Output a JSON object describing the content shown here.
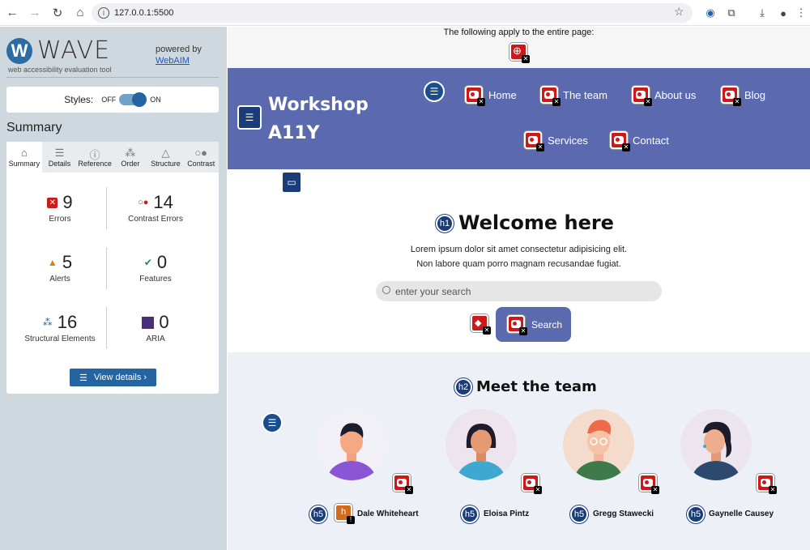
{
  "browser": {
    "url": "127.0.0.1:5500"
  },
  "wave": {
    "logo_text": "WAVE",
    "subtitle": "web accessibility evaluation tool",
    "powered_by": "powered by",
    "webaim_link": "WebAIM",
    "styles_label": "Styles:",
    "styles_off": "OFF",
    "styles_on": "ON",
    "summary_title": "Summary",
    "tabs": [
      {
        "label": "Summary",
        "icon": "home-icon"
      },
      {
        "label": "Details",
        "icon": "list-icon"
      },
      {
        "label": "Reference",
        "icon": "info-icon"
      },
      {
        "label": "Order",
        "icon": "order-icon"
      },
      {
        "label": "Structure",
        "icon": "structure-icon"
      },
      {
        "label": "Contrast",
        "icon": "contrast-icon"
      }
    ],
    "stats": {
      "errors": {
        "count": "9",
        "label": "Errors"
      },
      "contrast_errors": {
        "count": "14",
        "label": "Contrast Errors"
      },
      "alerts": {
        "count": "5",
        "label": "Alerts"
      },
      "features": {
        "count": "0",
        "label": "Features"
      },
      "structural": {
        "count": "16",
        "label": "Structural Elements"
      },
      "aria": {
        "count": "0",
        "label": "ARIA"
      }
    },
    "view_details": "View details ›"
  },
  "page": {
    "top_note": "The following apply to the entire page:",
    "site_title": "Workshop A11Y",
    "nav": [
      "Home",
      "The team",
      "About us",
      "Blog",
      "Services",
      "Contact"
    ],
    "hero_badge": "h1",
    "hero_title": "Welcome here",
    "hero_lines": [
      "Lorem ipsum dolor sit amet consectetur adipisicing elit.",
      "Non labore quam porro magnam recusandae fugiat."
    ],
    "search_placeholder": "enter your search",
    "search_button": "Search",
    "team_badge": "h2",
    "team_title": "Meet the team",
    "members": [
      {
        "badge": "h5",
        "name": "Dale Whiteheart"
      },
      {
        "badge": "h5",
        "name": "Eloisa Pintz"
      },
      {
        "badge": "h5",
        "name": "Gregg Stawecki"
      },
      {
        "badge": "h5",
        "name": "Gaynelle Causey"
      }
    ]
  },
  "colors": {
    "header_bg": "#5b6aaf",
    "wave_blue": "#2464a0",
    "error_red": "#cc1a1a"
  }
}
